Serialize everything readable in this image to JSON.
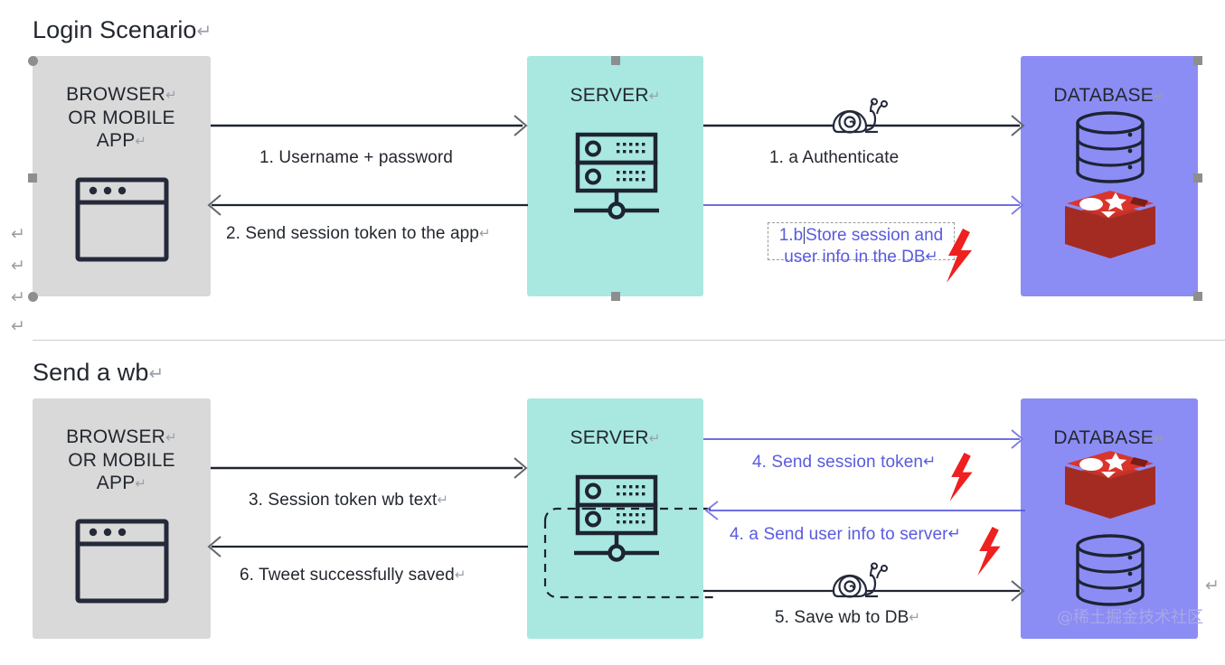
{
  "document": {
    "watermark": "@稀土掘金技术社区",
    "return_mark": "↵"
  },
  "colors": {
    "browser_box": "#d9d9d9",
    "server_box": "#a8e8e0",
    "database_box": "#8c8cf5",
    "arrow_dark": "#1f2430",
    "arrow_purple": "#5a5ae0",
    "text_dark": "#23272f",
    "text_purple": "#5a5ae0",
    "bolt_red": "#ef2020",
    "redis_red": "#d9352c",
    "handle_gray": "#8e8e8e"
  },
  "sections": [
    {
      "title": "Login Scenario",
      "nodes": [
        {
          "id": "browser",
          "label": "BROWSER\nOR MOBILE\nAPP",
          "icon": "browser-window-icon"
        },
        {
          "id": "server",
          "label": "SERVER",
          "icon": "server-rack-icon"
        },
        {
          "id": "database",
          "label": "DATABASE",
          "icons": [
            "database-cylinder-icon",
            "redis-logo-icon"
          ]
        }
      ],
      "arrows": [
        {
          "id": "a1",
          "label": "1. Username + password",
          "direction": "right",
          "color": "dark"
        },
        {
          "id": "a2",
          "label": "2. Send session token to the app",
          "direction": "left",
          "color": "dark"
        },
        {
          "id": "a3",
          "label": "1. a Authenticate",
          "direction": "right",
          "color": "dark",
          "icon": "snail-icon"
        },
        {
          "id": "a4",
          "label": "",
          "direction": "right",
          "color": "purple"
        }
      ],
      "callout": {
        "prefix": "1.b",
        "line1": "Store session and",
        "line2": "user info in the DB",
        "icon": "lightning-bolt-icon"
      }
    },
    {
      "title": "Send a wb",
      "nodes": [
        {
          "id": "browser2",
          "label": "BROWSER\nOR MOBILE\nAPP",
          "icon": "browser-window-icon"
        },
        {
          "id": "server2",
          "label": "SERVER",
          "icon": "server-rack-icon"
        },
        {
          "id": "database2",
          "label": "DATABASE",
          "icons": [
            "redis-logo-icon",
            "database-cylinder-icon"
          ]
        }
      ],
      "arrows": [
        {
          "id": "b1",
          "label": "3. Session token wb text",
          "direction": "right",
          "color": "dark"
        },
        {
          "id": "b2",
          "label": "6. Tweet successfully saved",
          "direction": "left",
          "color": "dark"
        },
        {
          "id": "b3",
          "label": "4. Send session token",
          "direction": "right",
          "color": "purple",
          "icon": "lightning-bolt-icon"
        },
        {
          "id": "b4",
          "label": "4. a Send user info to server",
          "direction": "left",
          "color": "purple",
          "icon": "lightning-bolt-icon"
        },
        {
          "id": "b5",
          "label": "5. Save wb to DB",
          "direction": "right",
          "color": "dark",
          "icon": "snail-icon"
        }
      ]
    }
  ],
  "labels": {
    "browser_line1": "BROWSER",
    "browser_line2": "OR MOBILE",
    "browser_line3": "APP",
    "server": "SERVER",
    "database": "DATABASE"
  }
}
